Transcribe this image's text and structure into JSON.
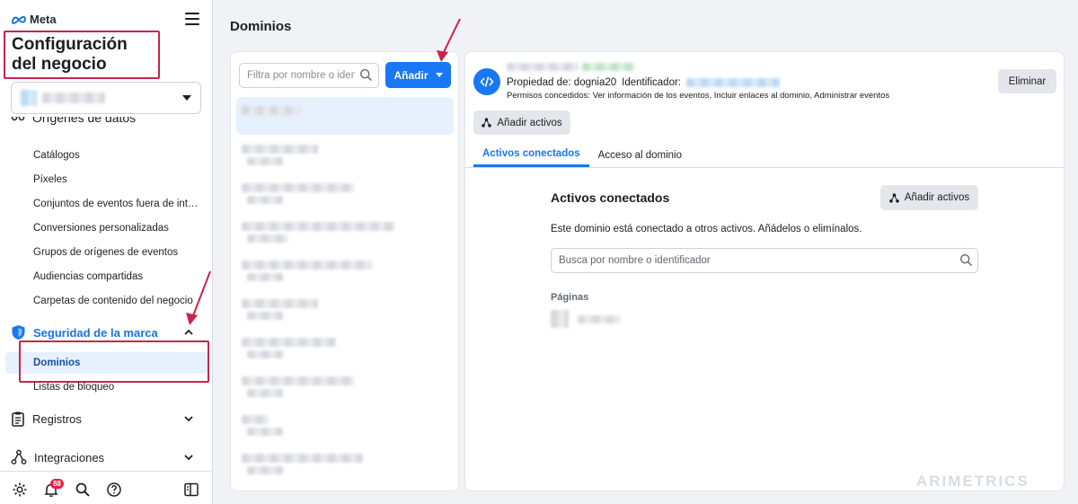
{
  "sidebar": {
    "brand": "Meta",
    "business_title": "Configuración del negocio",
    "cut_heading": "Orígenes de datos",
    "sub_items": [
      "Catálogos",
      "Píxeles",
      "Conjuntos de eventos fuera de internet",
      "Conversiones personalizadas",
      "Grupos de orígenes de eventos",
      "Audiencias compartidas",
      "Carpetas de contenido del negocio"
    ],
    "brand_safety": "Seguridad de la marca",
    "brand_safety_items": [
      "Dominios",
      "Listas de bloqueo"
    ],
    "sections": [
      "Registros",
      "Integraciones"
    ],
    "notification_count": "88"
  },
  "main": {
    "title": "Dominios",
    "filter_placeholder": "Filtra por nombre o identificador",
    "add_label": "Añadir"
  },
  "detail": {
    "owner_label": "Propiedad de: dognia20",
    "id_label": "Identificador:",
    "permissions": "Permisos concedidos: Ver información de los eventos, Incluir enlaces al dominio, Administrar eventos",
    "delete_label": "Eliminar",
    "add_assets_label": "Añadir activos",
    "tabs": [
      "Activos conectados",
      "Acceso al dominio"
    ],
    "section_title": "Activos conectados",
    "section_add_label": "Añadir activos",
    "section_desc": "Este dominio está conectado a otros activos. Añádelos o elimínalos.",
    "search_placeholder": "Busca por nombre o identificador",
    "pages_label": "Páginas"
  },
  "watermark": "ARIMETRICS",
  "colors": {
    "accent": "#1877f2",
    "highlight": "#c8254a",
    "selected_bg": "#e7f0fd"
  }
}
